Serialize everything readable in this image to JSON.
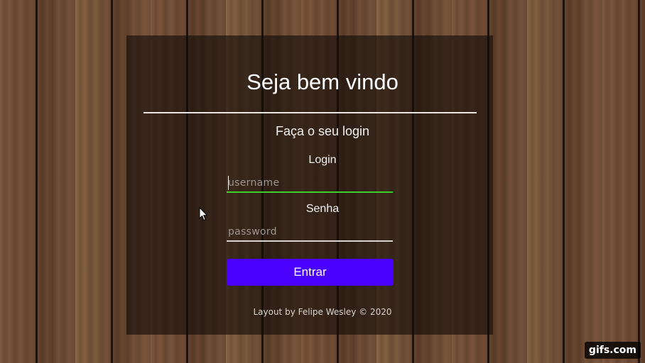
{
  "login_card": {
    "title": "Seja bem vindo",
    "subtitle": "Faça o seu login",
    "username": {
      "label": "Login",
      "placeholder": "username",
      "value": ""
    },
    "password": {
      "label": "Senha",
      "placeholder": "password",
      "value": ""
    },
    "submit_label": "Entrar",
    "footer_text": "Layout by Felipe Wesley © 2020"
  },
  "overlay": {
    "watermark": "gifs.com",
    "cursor_icon": "mouse-pointer-icon"
  },
  "colors": {
    "button": "#4a00ff",
    "focused_underline": "#3ecf2a",
    "underline": "#d8d3cd",
    "text": "#ffffff"
  }
}
